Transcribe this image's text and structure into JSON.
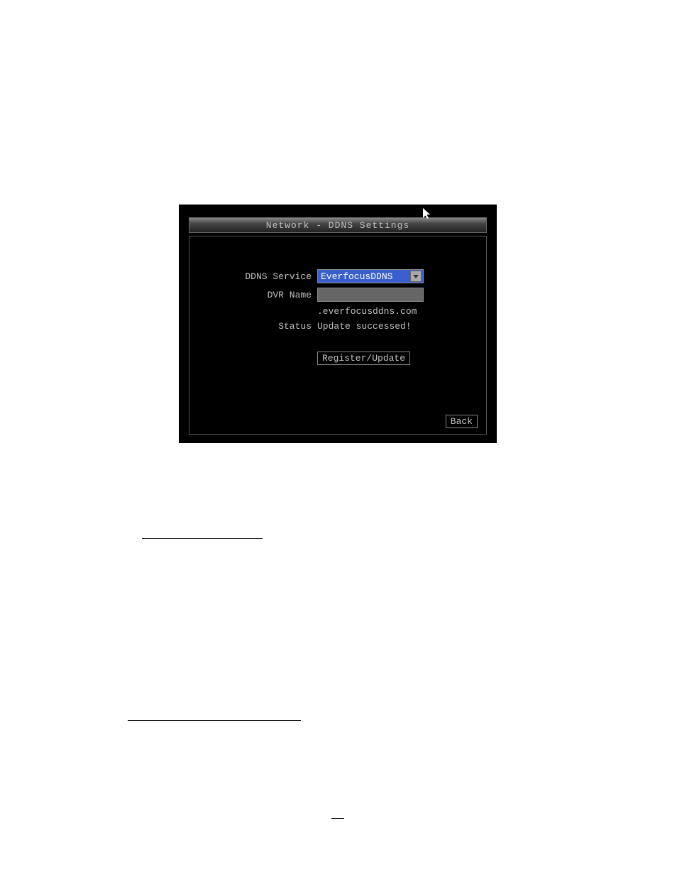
{
  "window": {
    "title": "Network - DDNS Settings"
  },
  "form": {
    "service_label": "DDNS Service",
    "service_value": "EverfocusDDNS",
    "name_label": "DVR Name",
    "name_value": "",
    "domain_suffix": ".everfocusddns.com",
    "status_label": "Status",
    "status_value": "Update successed!",
    "register_label": "Register/Update",
    "back_label": "Back"
  }
}
